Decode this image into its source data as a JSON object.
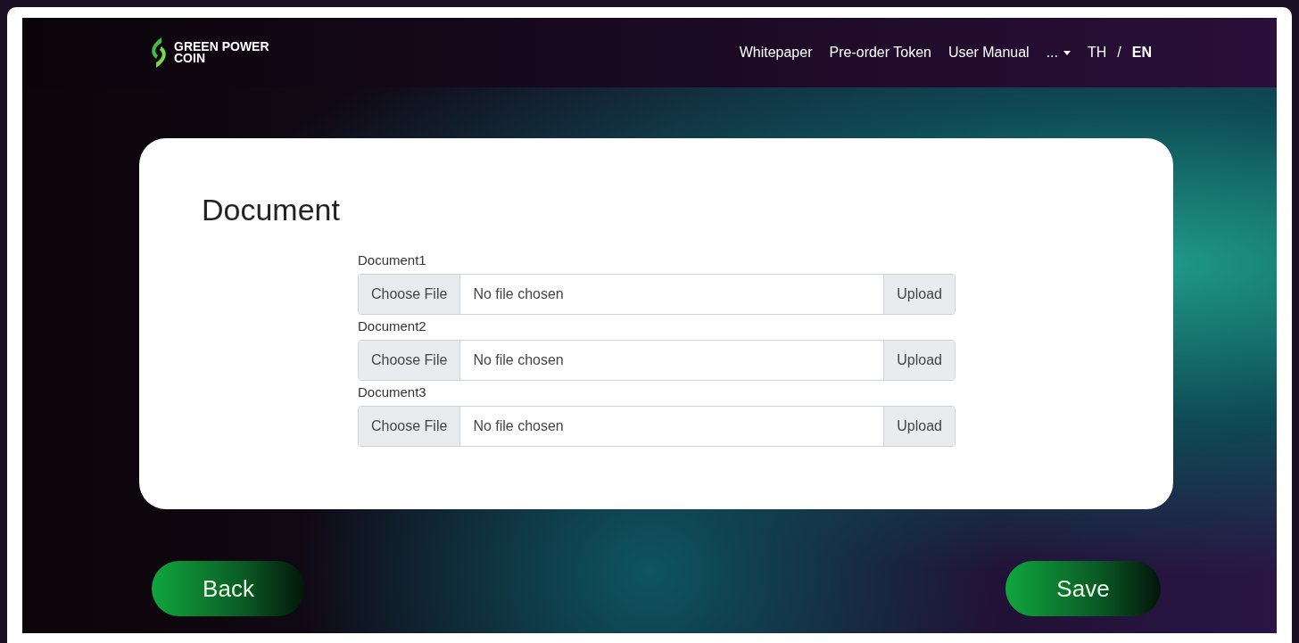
{
  "brand": {
    "line1": "GREEN POWER",
    "line2": "COIN"
  },
  "nav": {
    "links": [
      "Whitepaper",
      "Pre-order Token",
      "User Manual"
    ],
    "more": "...",
    "languages": [
      {
        "label": "TH",
        "selected": false
      },
      {
        "label": "EN",
        "selected": true
      }
    ],
    "separator": "/"
  },
  "card": {
    "title": "Document",
    "documents": [
      {
        "label": "Document1",
        "choose": "Choose File",
        "status": "No file chosen",
        "upload": "Upload"
      },
      {
        "label": "Document2",
        "choose": "Choose File",
        "status": "No file chosen",
        "upload": "Upload"
      },
      {
        "label": "Document3",
        "choose": "Choose File",
        "status": "No file chosen",
        "upload": "Upload"
      }
    ]
  },
  "buttons": {
    "back": "Back",
    "save": "Save"
  }
}
